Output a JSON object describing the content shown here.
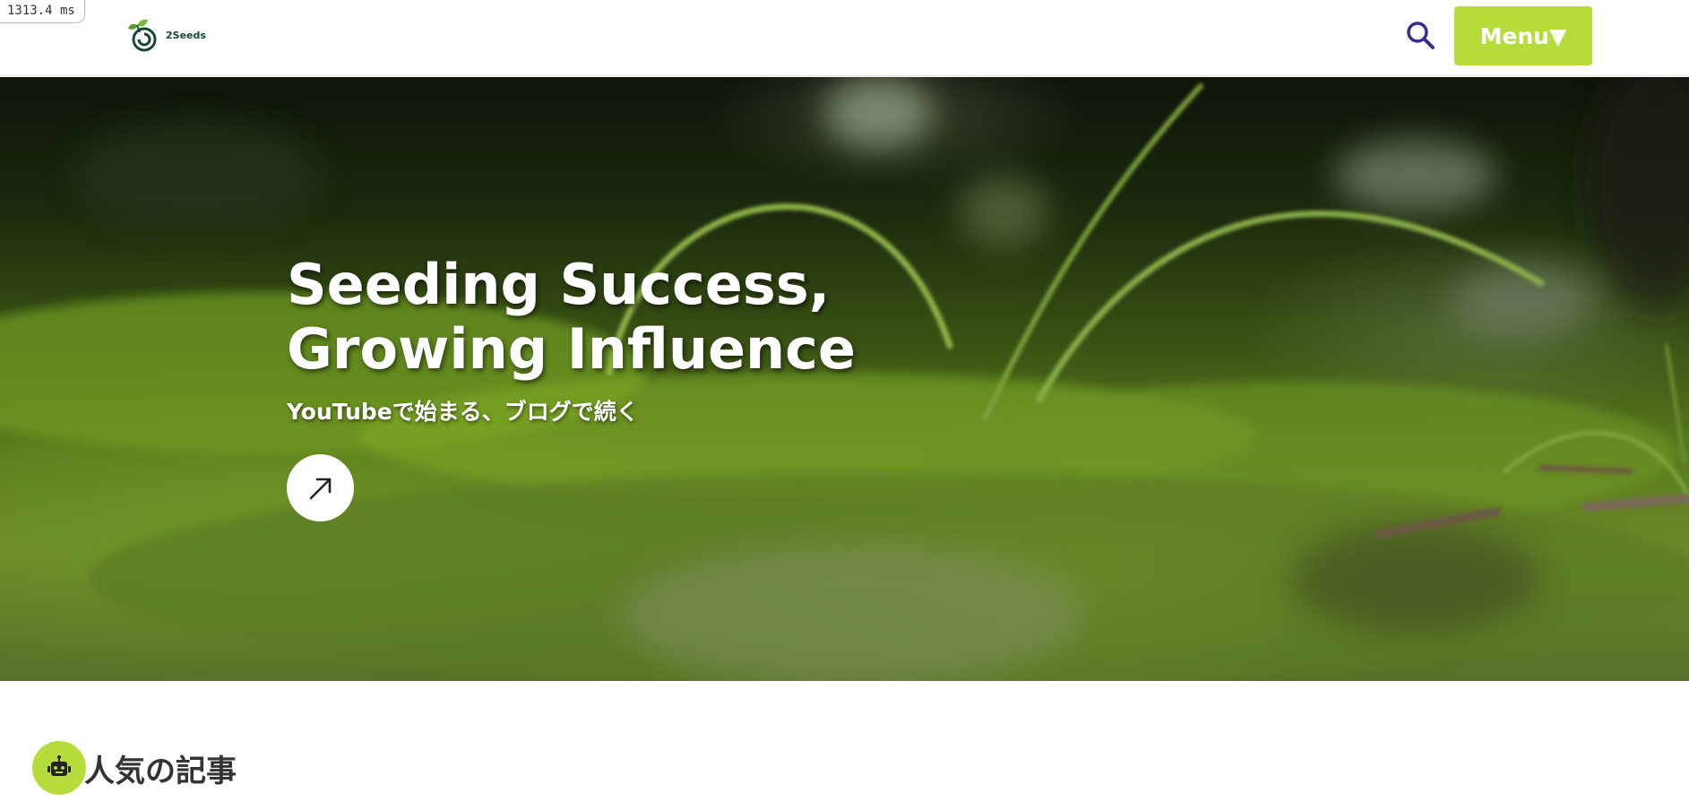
{
  "timing": {
    "label": "1313.4 ms"
  },
  "header": {
    "logo_text": "2Seeds",
    "menu_label": "Menu▼"
  },
  "hero": {
    "title_line1": "Seeding Success,",
    "title_line2": "Growing Influence",
    "subtitle": "YouTubeで始まる、ブログで続く"
  },
  "popular": {
    "title": "人気の記事"
  },
  "icons": {
    "search": "search-icon",
    "arrow": "arrow-up-right-icon",
    "robot": "robot-icon",
    "logo": "seed-logo-icon"
  },
  "colors": {
    "accent": "#b5dc3b",
    "search_icon": "#3b2a8f",
    "heading_text": "#333333"
  }
}
